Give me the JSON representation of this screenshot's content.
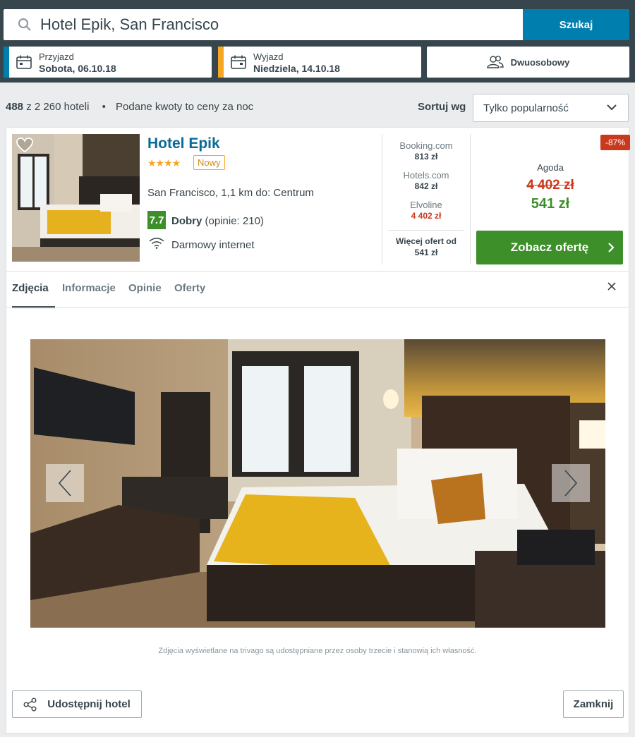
{
  "search": {
    "value": "Hotel Epik, San Francisco",
    "button_label": "Szukaj"
  },
  "dates": {
    "checkin_label": "Przyjazd",
    "checkin_value": "Sobota, 06.10.18",
    "checkout_label": "Wyjazd",
    "checkout_value": "Niedziela, 14.10.18",
    "checkin_accent": "#007faf",
    "checkout_accent": "#f5a623"
  },
  "room": {
    "label": "Dwuosobowy"
  },
  "results": {
    "count": "488",
    "of_total": "z 2 260 hoteli",
    "note": "Podane kwoty to ceny za noc",
    "sort_label": "Sortuj wg",
    "sort_value": "Tylko popularność"
  },
  "hotel": {
    "name": "Hotel Epik",
    "stars": "★★★★",
    "new_badge": "Nowy",
    "location": "San Francisco, 1,1 km do: Centrum",
    "rating_score": "7.7",
    "rating_word": "Dobry",
    "rating_count": "(opinie: 210)",
    "amenity": "Darmowy internet"
  },
  "providers": [
    {
      "name": "Booking.com",
      "price": "813 zł"
    },
    {
      "name": "Hotels.com",
      "price": "842 zł"
    },
    {
      "name": "Elvoline",
      "price": "4 402 zł"
    }
  ],
  "more_offers": {
    "line1": "Więcej ofert od",
    "line2": "541 zł"
  },
  "deal": {
    "discount": "-87%",
    "provider": "Agoda",
    "old_price": "4 402 zł",
    "new_price": "541 zł",
    "button_label": "Zobacz ofertę"
  },
  "tabs": [
    "Zdjęcia",
    "Informacje",
    "Opinie",
    "Oferty"
  ],
  "gallery": {
    "disclaimer": "Zdjęcia wyświetlane na trivago są udostępniane przez osoby trzecie i stanowią ich własność."
  },
  "footer": {
    "share_label": "Udostępnij hotel",
    "close_label": "Zamknij"
  }
}
